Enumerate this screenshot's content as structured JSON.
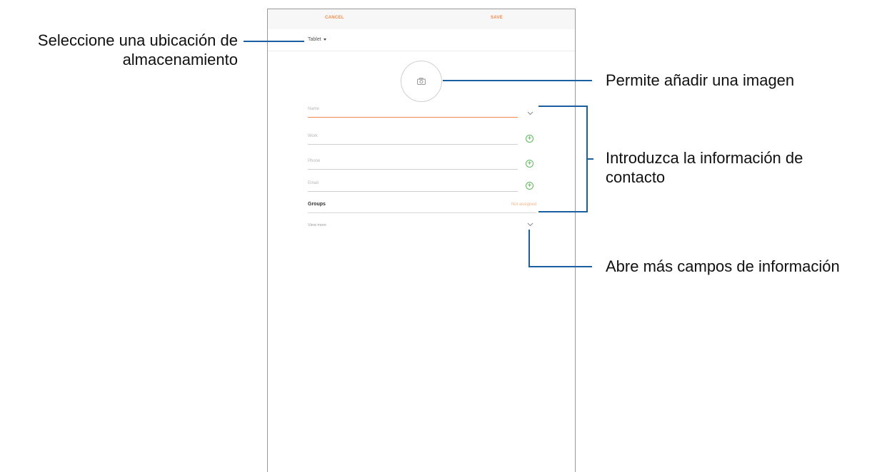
{
  "topbar": {
    "cancel": "CANCEL",
    "save": "SAVE"
  },
  "storage": {
    "label": "Tablet"
  },
  "form": {
    "name_placeholder": "Name",
    "work_placeholder": "Work",
    "phone_placeholder": "Phone",
    "email_placeholder": "Email",
    "groups_label": "Groups",
    "groups_value": "Not assigned",
    "view_more": "View more",
    "plus_symbol": "+"
  },
  "icons": {
    "camera": "camera-icon",
    "chevron": "chevron-down-icon",
    "caret": "caret-down-icon",
    "plus": "plus-icon"
  },
  "callouts": {
    "storage_line1": "Seleccione una ubicación de",
    "storage_line2": "almacenamiento",
    "image": "Permite añadir una imagen",
    "contact_line1": "Introduzca la información de",
    "contact_line2": "contacto",
    "more": "Abre más campos de información"
  },
  "colors": {
    "accent_orange": "#f2894a",
    "plus_green": "#4aa84a",
    "callout_line": "#1a5fa0"
  }
}
